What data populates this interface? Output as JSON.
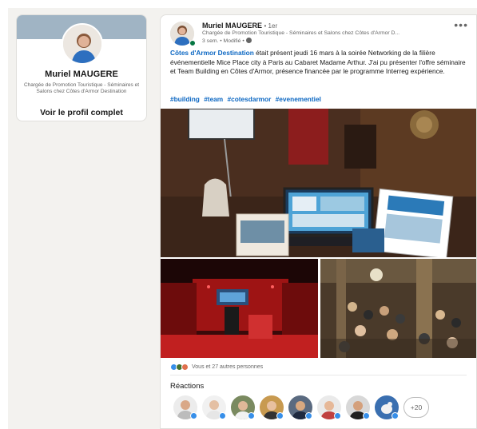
{
  "sidebar": {
    "profile": {
      "name": "Muriel MAUGERE",
      "headline": "Chargée de Promotion Touristique - Séminaires et Salons chez Côtes d'Armor Destination",
      "view_profile_label": "Voir le profil complet"
    }
  },
  "post": {
    "author": {
      "name": "Muriel MAUGERE",
      "degree": "• 1er",
      "headline": "Chargée de Promotion Touristique - Séminaires et Salons chez Côtes d'Armor D...",
      "meta": "3 sem. • Modifié •"
    },
    "more_label": "•••",
    "mention": "Côtes d'Armor Destination",
    "body": " était présent jeudi 16 mars à la soirée Networking de la filière événementielle Mice Place city à Paris au Cabaret Madame Arthur. J'ai pu présenter l'offre séminaire et Team Building en Côtes d'Armor, présence financée par le programme Interreg expérience.",
    "hashtags": [
      "#building",
      "#team",
      "#cotesdarmor",
      "#evenementiel"
    ],
    "reaction_summary": "Vous et 27 autres personnes",
    "reactions_title": "Réactions",
    "more_reactors_label": "+20"
  },
  "colors": {
    "link": "#0a66c2",
    "like": "#378fe9",
    "celebrate": "#44712e",
    "love": "#df704d",
    "online": "#057642"
  }
}
